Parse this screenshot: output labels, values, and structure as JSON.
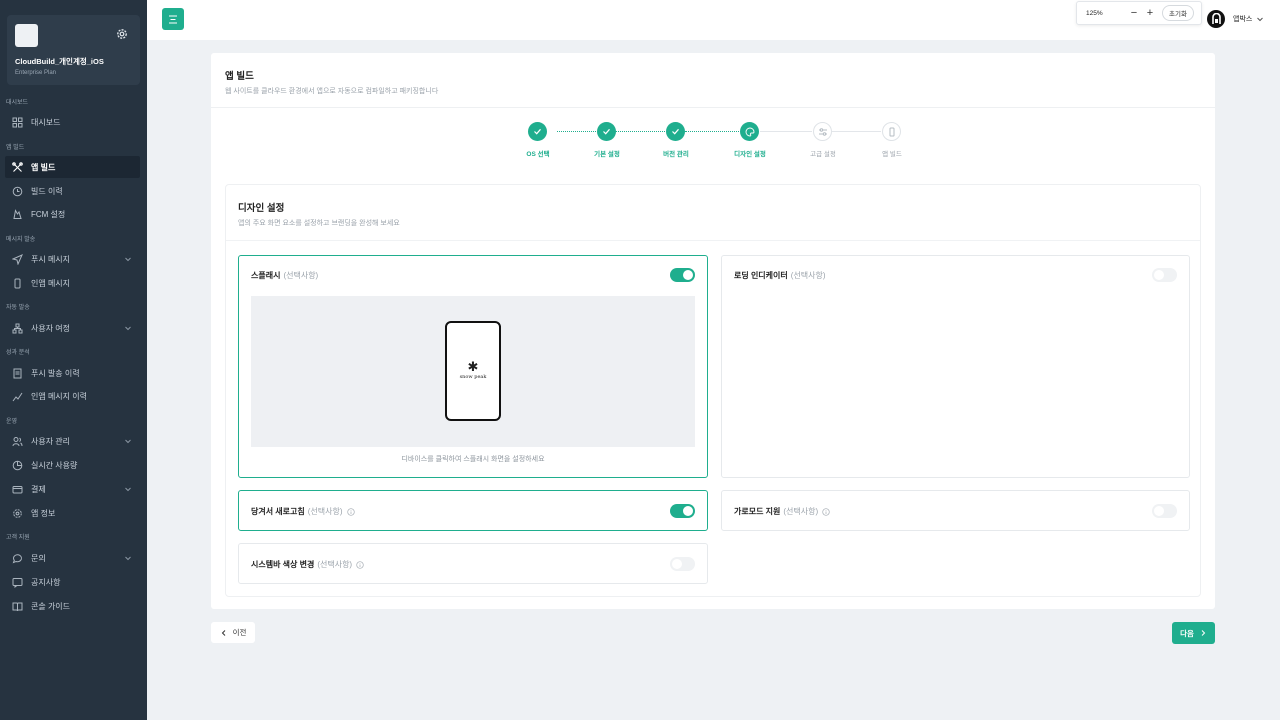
{
  "sidebar": {
    "account_name": "CloudBuild_개인계정_iOS",
    "account_plan": "Enterprise Plan",
    "sections": [
      {
        "label": "대시보드"
      },
      {
        "label": "앱 빌드"
      },
      {
        "label": "메시지 발송"
      },
      {
        "label": "자동 발송"
      },
      {
        "label": "성과 분석"
      },
      {
        "label": "운영"
      },
      {
        "label": "고객 지원"
      }
    ],
    "items": [
      {
        "label": "대시보드",
        "icon": "grid-icon"
      },
      {
        "label": "앱 빌드",
        "icon": "tools-icon"
      },
      {
        "label": "빌드 이력",
        "icon": "history-icon"
      },
      {
        "label": "FCM 설정",
        "icon": "fire-icon"
      },
      {
        "label": "푸시 메시지",
        "icon": "send-icon"
      },
      {
        "label": "인앱 메시지",
        "icon": "phone-icon"
      },
      {
        "label": "사용자 여정",
        "icon": "flow-icon"
      },
      {
        "label": "푸시 발송 이력",
        "icon": "report-icon"
      },
      {
        "label": "인앱 메시지 이력",
        "icon": "chart-icon"
      },
      {
        "label": "사용자 관리",
        "icon": "users-icon"
      },
      {
        "label": "실시간 사용량",
        "icon": "pie-icon"
      },
      {
        "label": "결제",
        "icon": "card-icon"
      },
      {
        "label": "앱 정보",
        "icon": "gear-icon"
      },
      {
        "label": "문의",
        "icon": "chat-icon"
      },
      {
        "label": "공지사항",
        "icon": "notice-icon"
      },
      {
        "label": "콘솔 가이드",
        "icon": "book-icon"
      }
    ]
  },
  "topbar": {
    "zoom": "125%",
    "zoom_out": "−",
    "zoom_in": "+",
    "reset": "초기화",
    "user_name": "앱박스"
  },
  "page": {
    "title": "앱 빌드",
    "subtitle": "웹 사이트를 클라우드 환경에서 앱으로 자동으로 컴파일하고 패키징합니다"
  },
  "steps": [
    {
      "label": "OS 선택",
      "state": "done"
    },
    {
      "label": "기본 설정",
      "state": "done"
    },
    {
      "label": "버전 관리",
      "state": "done"
    },
    {
      "label": "디자인 설정",
      "state": "done"
    },
    {
      "label": "고급 설정",
      "state": "todo"
    },
    {
      "label": "앱 빌드",
      "state": "todo"
    }
  ],
  "design": {
    "title": "디자인 설정",
    "description": "앱의 주요 화면 요소를 설정하고 브랜딩을 완성해 보세요",
    "optional": "(선택사항)",
    "options": {
      "splash": {
        "label": "스플래시",
        "enabled": true
      },
      "loading": {
        "label": "로딩 인디케이터",
        "enabled": false
      },
      "pull_refresh": {
        "label": "당겨서 새로고침",
        "enabled": true
      },
      "landscape": {
        "label": "가로모드 지원",
        "enabled": false
      },
      "statusbar": {
        "label": "시스템바 색상 변경",
        "enabled": false
      }
    },
    "splash_brand": "snow peak",
    "splash_hint": "디바이스를 클릭하여 스플래시 화면을 설정하세요"
  },
  "nav": {
    "prev": "이전",
    "next": "다음"
  },
  "colors": {
    "accent": "#1fae8e",
    "sidebar": "#263340"
  }
}
